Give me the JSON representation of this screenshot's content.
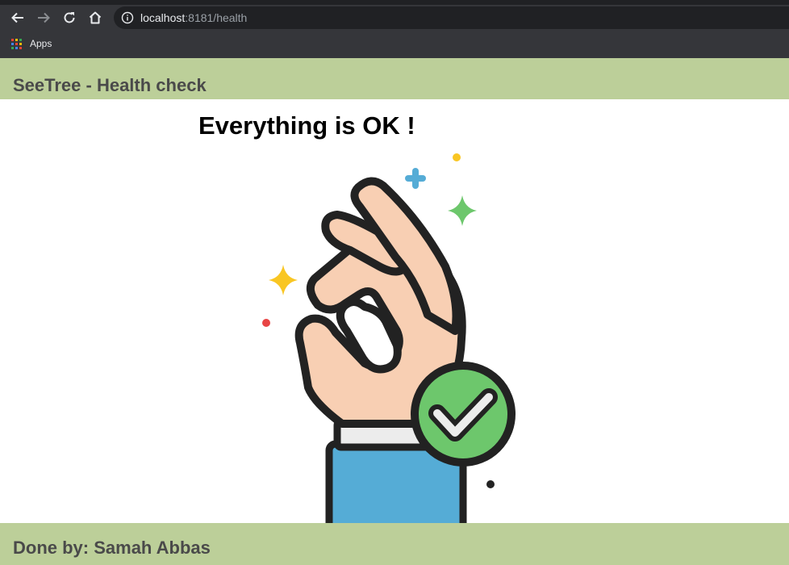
{
  "browser": {
    "url_host": "localhost",
    "url_rest": ":8181/health",
    "bookmarks": {
      "apps_label": "Apps"
    },
    "icons": [
      "back-arrow-icon",
      "forward-arrow-icon",
      "reload-icon",
      "home-icon",
      "info-icon",
      "apps-grid-icon"
    ]
  },
  "page": {
    "header_title": "SeeTree - Health check",
    "status_message": "Everything is OK !",
    "footer_text": "Done by: Samah Abbas",
    "colors": {
      "bar_background": "#bccf99",
      "bar_text": "#4a4a4a",
      "check_badge": "#6dc76c",
      "sleeve": "#55acd6",
      "skin": "#f8cfb3"
    },
    "illustration": "ok-hand-checkmark-icon"
  }
}
